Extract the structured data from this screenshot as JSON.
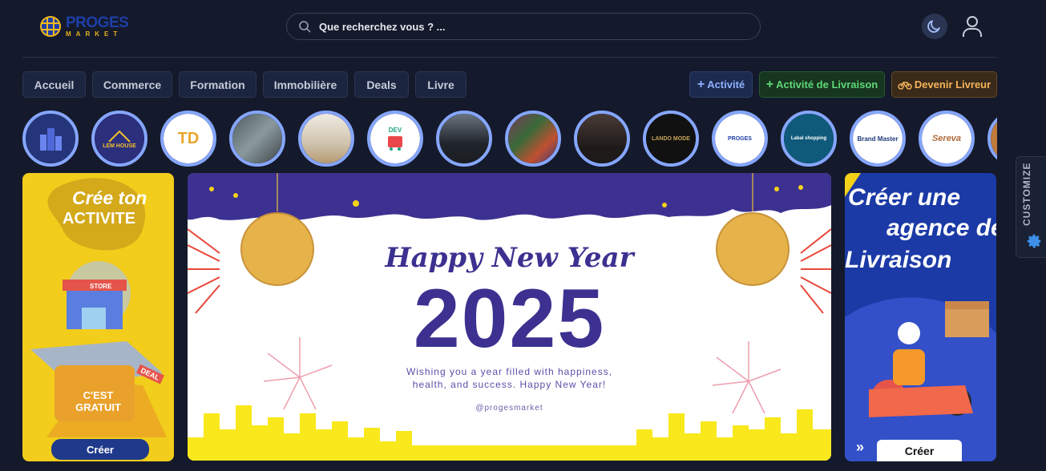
{
  "header": {
    "logo_name": "PROGES",
    "logo_sub": "MARKET",
    "search_placeholder": "Que recherchez vous ? ..."
  },
  "nav": {
    "items": [
      {
        "label": "Accueil"
      },
      {
        "label": "Commerce"
      },
      {
        "label": "Formation"
      },
      {
        "label": "Immobilière"
      },
      {
        "label": "Deals"
      },
      {
        "label": "Livre"
      }
    ]
  },
  "actions": {
    "activite": "Activité",
    "livraison": "Activité de Livraison",
    "livreur": "Devenir Livreur"
  },
  "stories": [
    {
      "name": "Buildings",
      "text": "",
      "color": "#24357a"
    },
    {
      "name": "LEM HOUSE",
      "text": "LEM HOUSE",
      "color": "#2b2f7c"
    },
    {
      "name": "TD",
      "text": "TD",
      "color": "#e9a52b"
    },
    {
      "name": "Street",
      "text": "",
      "color": "#5b6a70"
    },
    {
      "name": "Room",
      "text": "",
      "color": "#d9d1c1"
    },
    {
      "name": "DEV",
      "text": "DEV",
      "color": "#ffffff"
    },
    {
      "name": "Car",
      "text": "",
      "color": "#2b3036"
    },
    {
      "name": "Books",
      "text": "",
      "color": "#5a3a4a"
    },
    {
      "name": "Rider",
      "text": "",
      "color": "#3a3030"
    },
    {
      "name": "LANDO MODE",
      "text": "LANDO MODE",
      "color": "#111111"
    },
    {
      "name": "PROGES",
      "text": "PROGES",
      "color": "#ffffff"
    },
    {
      "name": "Labal shopping",
      "text": "Labal shopping",
      "color": "#0f5a7a"
    },
    {
      "name": "Brand Master",
      "text": "Brand Master",
      "color": "#ffffff"
    },
    {
      "name": "Sereva",
      "text": "Sereva",
      "color": "#ffffff"
    },
    {
      "name": "Partial",
      "text": "",
      "color": "#c07a3a"
    }
  ],
  "banner_left": {
    "title_1": "Crée ton",
    "title_2": "ACTIVITE",
    "store_sign": "STORE",
    "deal_tag": "DEAL",
    "free_1": "C'EST",
    "free_2": "GRATUIT",
    "cta": "Créer"
  },
  "banner_main": {
    "heading": "Happy New Year",
    "year": "2025",
    "wish_1": "Wishing you a year filled with happiness,",
    "wish_2": "health, and success. Happy New Year!",
    "handle": "@progesmarket"
  },
  "banner_right": {
    "title_1": "Créer une",
    "title_2": "agence de",
    "title_3": "Livraison",
    "cta": "Créer"
  },
  "customize": {
    "label": "CUSTOMIZE"
  }
}
